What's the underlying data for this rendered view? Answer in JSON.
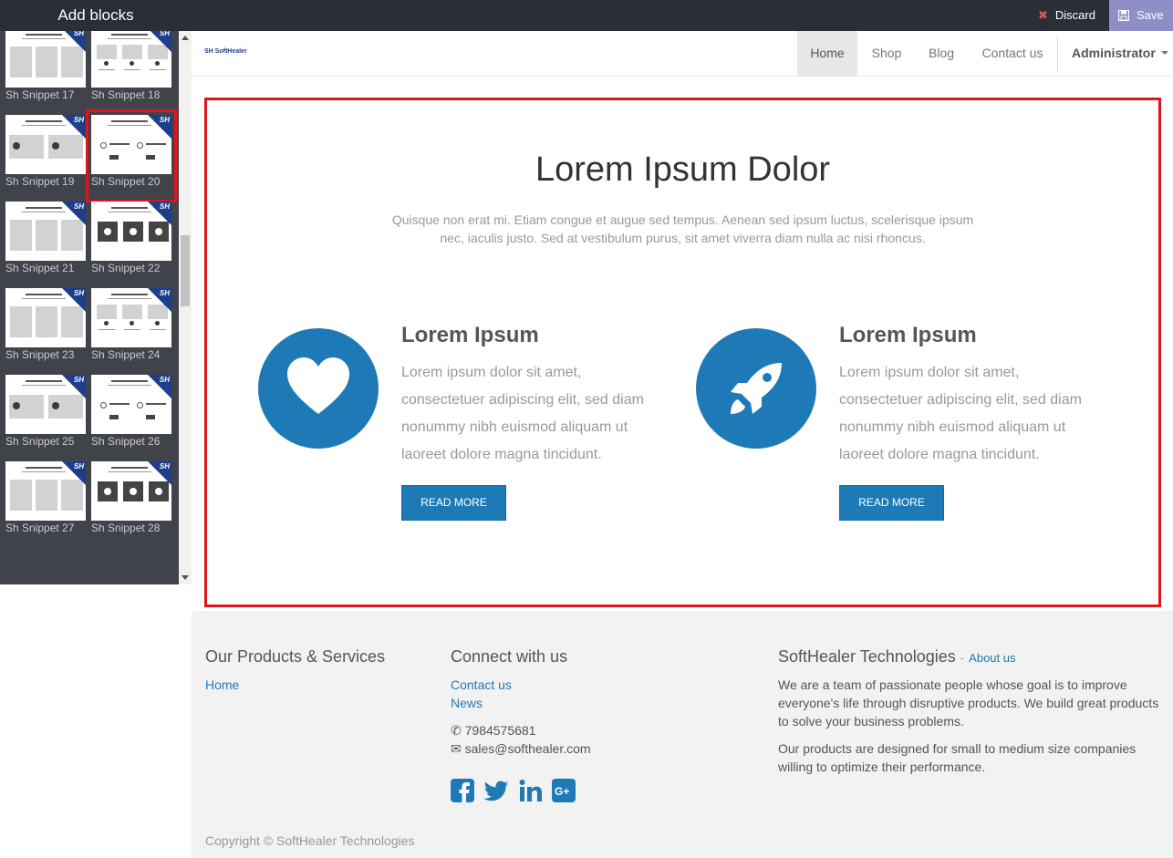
{
  "editor": {
    "title": "Add blocks",
    "discard_label": "Discard",
    "save_label": "Save"
  },
  "snippets": [
    {
      "label": "Sh Snippet 17"
    },
    {
      "label": "Sh Snippet 18"
    },
    {
      "label": "Sh Snippet 19"
    },
    {
      "label": "Sh Snippet 20",
      "selected": true
    },
    {
      "label": "Sh Snippet 21"
    },
    {
      "label": "Sh Snippet 22"
    },
    {
      "label": "Sh Snippet 23"
    },
    {
      "label": "Sh Snippet 24"
    },
    {
      "label": "Sh Snippet 25"
    },
    {
      "label": "Sh Snippet 26"
    },
    {
      "label": "Sh Snippet 27"
    },
    {
      "label": "Sh Snippet 28"
    }
  ],
  "snippet_badge": "SH",
  "site": {
    "logo_text": "SH SoftHealer",
    "nav": [
      "Home",
      "Shop",
      "Blog",
      "Contact us"
    ],
    "user": "Administrator"
  },
  "block": {
    "title": "Lorem Ipsum Dolor",
    "lead": "Quisque non erat mi. Etiam congue et augue sed tempus. Aenean sed ipsum luctus, scelerisque ipsum nec, iaculis justo. Sed at vestibulum purus, sit amet viverra diam nulla ac nisi rhoncus.",
    "features": [
      {
        "icon": "heart-icon",
        "title": "Lorem Ipsum",
        "text": "Lorem ipsum dolor sit amet, consectetuer adipiscing elit, sed diam nonummy nibh euismod aliquam ut laoreet dolore magna tincidunt.",
        "button": "READ MORE"
      },
      {
        "icon": "rocket-icon",
        "title": "Lorem Ipsum",
        "text": "Lorem ipsum dolor sit amet, consectetuer adipiscing elit, sed diam nonummy nibh euismod aliquam ut laoreet dolore magna tincidunt.",
        "button": "READ MORE"
      }
    ]
  },
  "footer": {
    "products_title": "Our Products & Services",
    "products_links": [
      "Home"
    ],
    "connect_title": "Connect with us",
    "connect_links": [
      "Contact us",
      "News"
    ],
    "phone": "7984575681",
    "email": "sales@softhealer.com",
    "company_title": "SoftHealer Technologies",
    "about_link": "About us",
    "about_sep": "-",
    "about_p1": "We are a team of passionate people whose goal is to improve everyone's life through disruptive products. We build great products to solve your business problems.",
    "about_p2": "Our products are designed for small to medium size companies willing to optimize their performance.",
    "copyright": "Copyright © SoftHealer Technologies"
  },
  "colors": {
    "accent": "#1e7ab6",
    "selection": "#e0141a",
    "editor_bar": "#2c2e36",
    "save_button": "#8f8ec7"
  }
}
